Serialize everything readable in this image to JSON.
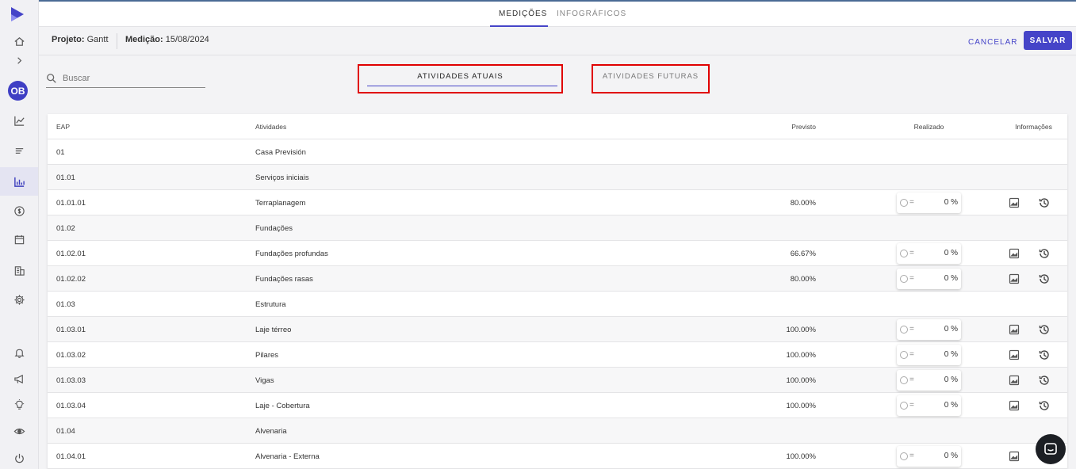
{
  "top_tabs": [
    "MEDIÇÕES",
    "INFOGRÁFICOS"
  ],
  "header": {
    "project_label": "Projeto:",
    "project_value": "Gantt",
    "measure_label": "Medição:",
    "measure_value": "15/08/2024",
    "cancel_label": "CANCELAR",
    "save_label": "SALVAR"
  },
  "search": {
    "placeholder": "Buscar"
  },
  "sub_tabs": [
    "ATIVIDADES ATUAIS",
    "ATIVIDADES FUTURAS"
  ],
  "sidebar": {
    "avatar_initials": "OB",
    "icons": [
      "home-icon",
      "chevron-right-icon",
      "chart-line-icon",
      "list-icon",
      "bar-chart-icon",
      "dollar-icon",
      "calendar-icon",
      "building-icon",
      "gear-icon",
      "bell-icon",
      "megaphone-icon",
      "lightbulb-icon",
      "eye-icon",
      "power-icon"
    ]
  },
  "table": {
    "headers": [
      "EAP",
      "Atividades",
      "Previsto",
      "Realizado",
      "Informações"
    ],
    "rows": [
      {
        "eap": "01",
        "activity": "Casa Previsión",
        "previsto": "",
        "realizado": ""
      },
      {
        "eap": "01.01",
        "activity": "Serviços iniciais",
        "previsto": "",
        "realizado": ""
      },
      {
        "eap": "01.01.01",
        "activity": "Terraplanagem",
        "previsto": "80.00%",
        "realizado": "0 %"
      },
      {
        "eap": "01.02",
        "activity": "Fundações",
        "previsto": "",
        "realizado": ""
      },
      {
        "eap": "01.02.01",
        "activity": "Fundações profundas",
        "previsto": "66.67%",
        "realizado": "0 %"
      },
      {
        "eap": "01.02.02",
        "activity": "Fundações rasas",
        "previsto": "80.00%",
        "realizado": "0 %"
      },
      {
        "eap": "01.03",
        "activity": "Estrutura",
        "previsto": "",
        "realizado": ""
      },
      {
        "eap": "01.03.01",
        "activity": "Laje térreo",
        "previsto": "100.00%",
        "realizado": "0 %"
      },
      {
        "eap": "01.03.02",
        "activity": "Pilares",
        "previsto": "100.00%",
        "realizado": "0 %"
      },
      {
        "eap": "01.03.03",
        "activity": "Vigas",
        "previsto": "100.00%",
        "realizado": "0 %"
      },
      {
        "eap": "01.03.04",
        "activity": "Laje - Cobertura",
        "previsto": "100.00%",
        "realizado": "0 %"
      },
      {
        "eap": "01.04",
        "activity": "Alvenaria",
        "previsto": "",
        "realizado": ""
      },
      {
        "eap": "01.04.01",
        "activity": "Alvenaria - Externa",
        "previsto": "100.00%",
        "realizado": "0 %"
      }
    ]
  },
  "colors": {
    "accent": "#4544c8",
    "highlight_border": "#e00000"
  }
}
